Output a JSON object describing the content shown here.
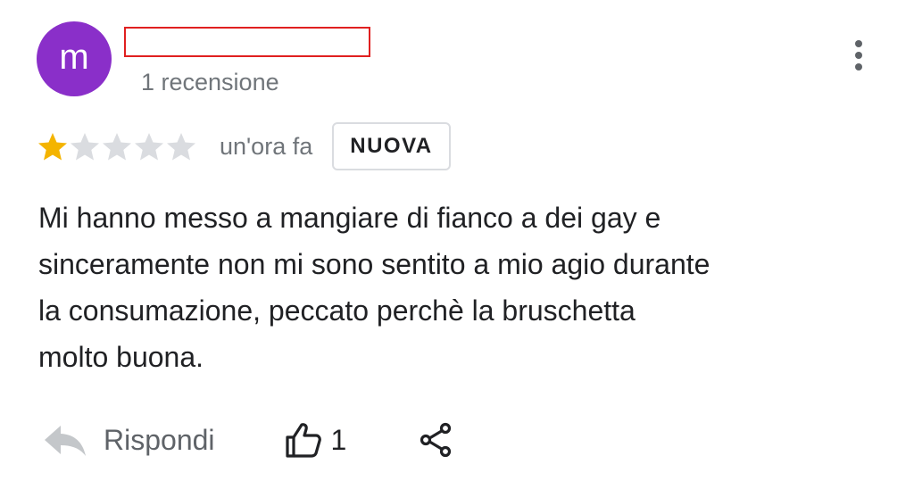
{
  "colors": {
    "avatar_bg": "#8a2fc9",
    "star_filled": "#f4b400",
    "star_empty": "#dadce0",
    "redaction_border": "#e02020"
  },
  "review": {
    "author": {
      "avatar_initial": "m",
      "review_count_label": "1 recensione"
    },
    "rating": 1,
    "rating_max": 5,
    "time_ago": "un'ora fa",
    "badge": "NUOVA",
    "text_lines": [
      "Mi hanno messo a mangiare di fianco a dei gay e",
      "sinceramente non mi sono sentito a mio agio durante",
      "la consumazione, peccato perchè la bruschetta",
      "molto buona."
    ]
  },
  "actions": {
    "reply_label": "Rispondi",
    "reply_icon": "reply-arrow-icon",
    "like_icon": "thumbs-up-icon",
    "like_count": "1",
    "share_icon": "share-icon",
    "more_icon": "more-vertical-icon"
  }
}
